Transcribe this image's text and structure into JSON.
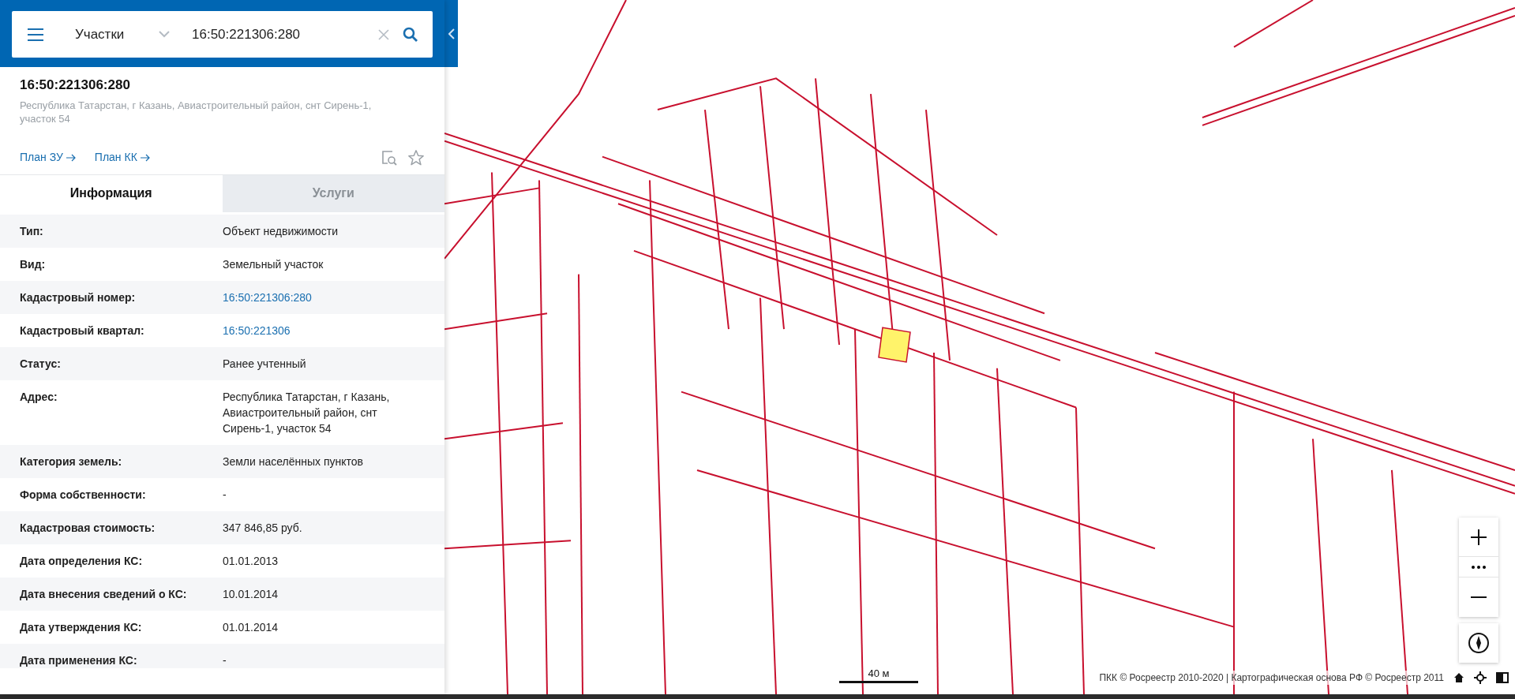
{
  "search": {
    "category": "Участки",
    "value": "16:50:221306:280"
  },
  "object": {
    "title": "16:50:221306:280",
    "address": "Республика Татарстан, г Казань, Авиастроительный район, снт Сирень-1, участок 54"
  },
  "links": [
    "План ЗУ",
    "План КК"
  ],
  "tabs": [
    {
      "label": "Информация",
      "selected": true
    },
    {
      "label": "Услуги",
      "selected": false
    }
  ],
  "rows": [
    {
      "label": "Тип:",
      "value": "Объект недвижимости",
      "kind": "text"
    },
    {
      "label": "Вид:",
      "value": "Земельный участок",
      "kind": "text"
    },
    {
      "label": "Кадастровый номер:",
      "value": "16:50:221306:280",
      "kind": "link"
    },
    {
      "label": "Кадастровый квартал:",
      "value": "16:50:221306",
      "kind": "link"
    },
    {
      "label": "Статус:",
      "value": "Ранее учтенный",
      "kind": "text"
    },
    {
      "label": "Адрес:",
      "value": "Республика Татарстан, г Казань, Авиастроительный район, снт Сирень-1, участок 54",
      "kind": "text"
    },
    {
      "label": "Категория земель:",
      "value": "Земли населённых пунктов",
      "kind": "text"
    },
    {
      "label": "Форма собственности:",
      "value": "-",
      "kind": "text"
    },
    {
      "label": "Кадастровая стоимость:",
      "value": "347 846,85 руб.",
      "kind": "text"
    },
    {
      "label": "Дата определения КС:",
      "value": "01.01.2013",
      "kind": "text"
    },
    {
      "label": "Дата внесения сведений о КС:",
      "value": "10.01.2014",
      "kind": "text"
    },
    {
      "label": "Дата утверждения КС:",
      "value": "01.01.2014",
      "kind": "text"
    },
    {
      "label": "Дата применения КС:",
      "value": "-",
      "kind": "text"
    }
  ],
  "map": {
    "scale": "40 м",
    "attribution": "ПКК © Росреестр 2010-2020 | Картографическая основа РФ © Росреестр 2011"
  }
}
